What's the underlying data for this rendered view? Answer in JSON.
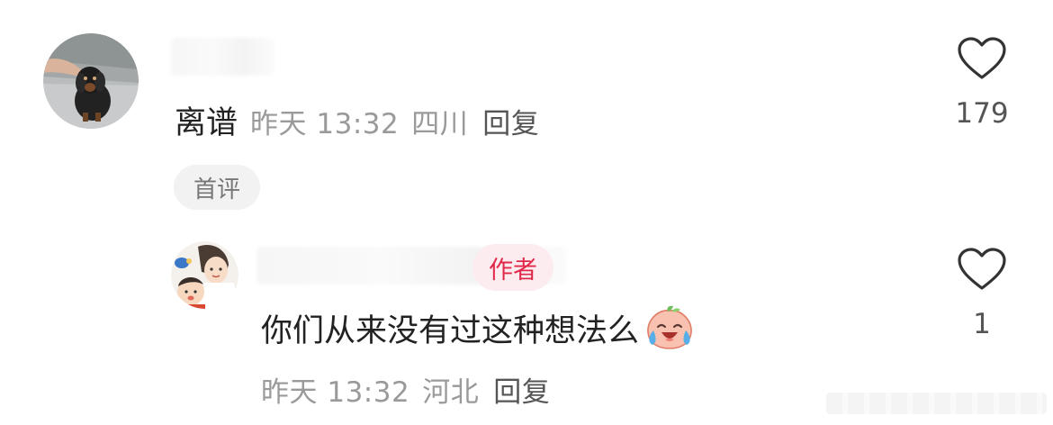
{
  "comment": {
    "text": "离谱",
    "time": "昨天 13:32",
    "location": "四川",
    "reply_label": "回复",
    "badge": "首评",
    "like_count": "179",
    "like_icon": "heart-outline-icon"
  },
  "reply": {
    "author_tag": "作者",
    "text": "你们从来没有过这种想法么",
    "emoji": "crying-laughing-peach-emoji",
    "time": "昨天 13:32",
    "location": "河北",
    "reply_label": "回复",
    "like_count": "1",
    "like_icon": "heart-outline-icon"
  },
  "colors": {
    "author_tag_text": "#e0284a",
    "author_tag_bg": "#fdecef",
    "meta_text": "#9a9a9a"
  }
}
